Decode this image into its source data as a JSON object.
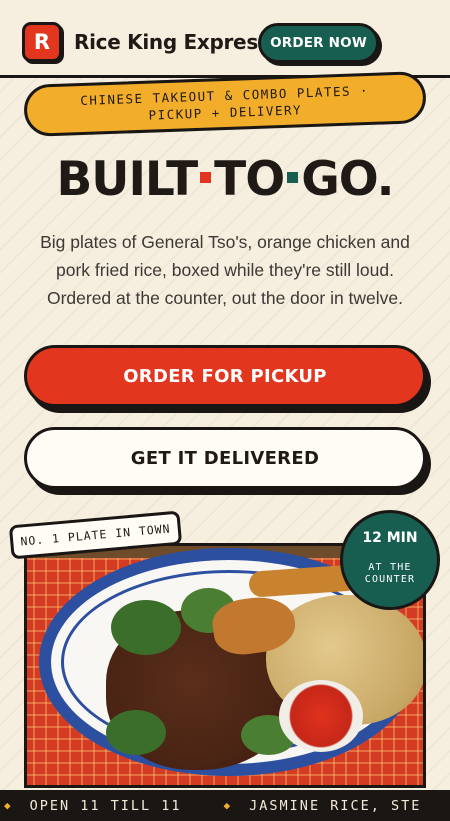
{
  "header": {
    "logo_letter": "R",
    "brand_name": "Rice King Express",
    "order_now_label": "ORDER NOW"
  },
  "banner": {
    "line1": "CHINESE TAKEOUT & COMBO PLATES ·",
    "line2": "PICKUP + DELIVERY"
  },
  "hero": {
    "headline_words": [
      "BUILT",
      "TO",
      "GO."
    ],
    "tagline": "Big plates of General Tso's, orange chicken and pork fried rice, boxed while they're still loud. Ordered at the counter, out the door in twelve."
  },
  "actions": {
    "pickup_label": "ORDER FOR PICKUP",
    "delivery_label": "GET IT DELIVERED"
  },
  "photo": {
    "sticker": "NO. 1 PLATE IN TOWN",
    "badge_main": "12 MIN",
    "badge_sub": "AT THE COUNTER"
  },
  "ticker": {
    "items": [
      "OPEN 11 TILL 11",
      "JASMINE RICE, STE"
    ]
  },
  "colors": {
    "accent_red": "#e3361f",
    "accent_green": "#175e51",
    "accent_yellow": "#f2ae2a",
    "ink": "#1a1614",
    "background": "#f6efe0"
  }
}
